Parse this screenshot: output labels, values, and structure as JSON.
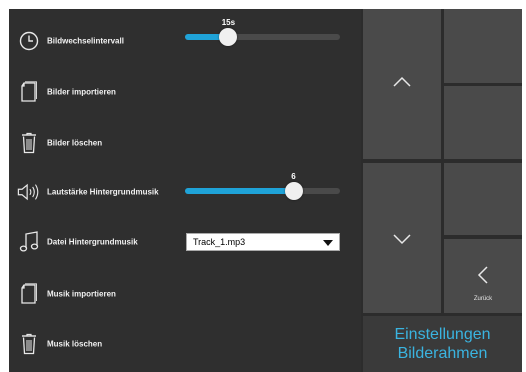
{
  "settings": {
    "interval": {
      "label": "Bildwechselintervall",
      "value_text": "15s",
      "level": 0.28
    },
    "import_images": {
      "label": "Bilder importieren"
    },
    "delete_images": {
      "label": "Bilder löschen"
    },
    "volume": {
      "label": "Lautstärke Hintergrundmusik",
      "value_text": "6",
      "level": 0.7
    },
    "music_file": {
      "label": "Datei Hintergrundmusik",
      "selected": "Track_1.mp3"
    },
    "import_music": {
      "label": "Musik importieren"
    },
    "delete_music": {
      "label": "Musik löschen"
    }
  },
  "nav": {
    "up_icon": "chevron-up-icon",
    "down_icon": "chevron-down-icon",
    "back_icon": "chevron-left-icon",
    "back_label": "Zurück"
  },
  "title": {
    "line1": "Einstellungen",
    "line2": "Bilderahmen"
  },
  "colors": {
    "accent": "#1fa3d8",
    "title_text": "#3ab4e0",
    "panel_bg": "#2f2f2f",
    "tile_bg": "#4a4a4a",
    "title_tile_bg": "#3a3a3a"
  }
}
